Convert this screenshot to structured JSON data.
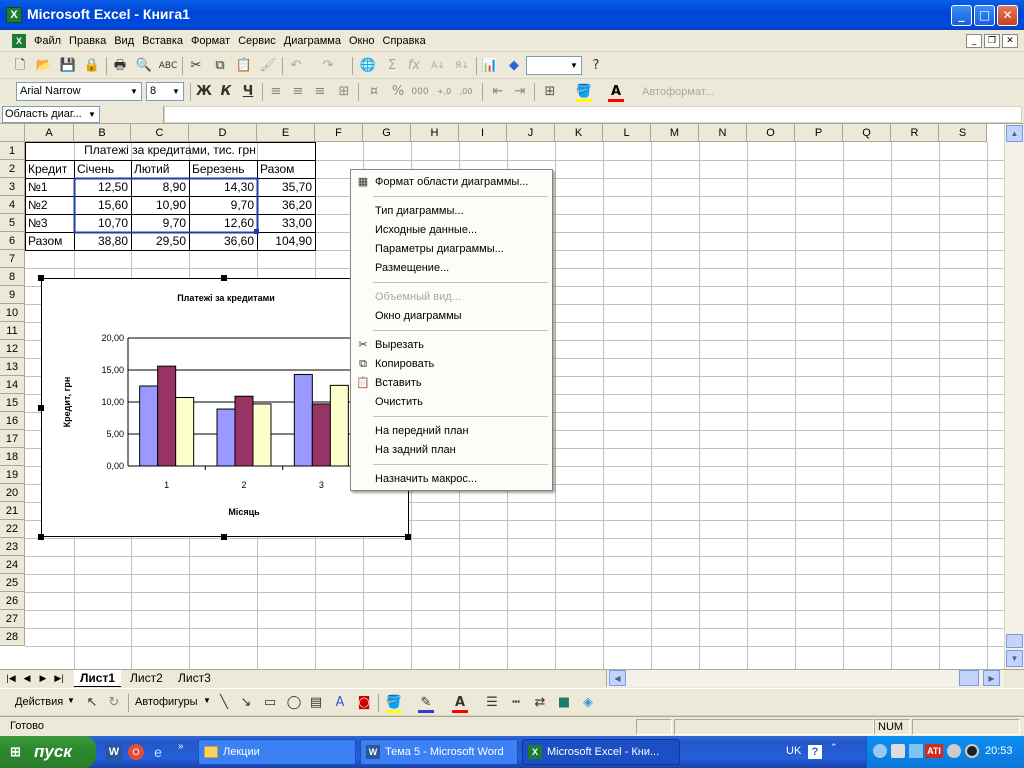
{
  "window": {
    "title": "Microsoft Excel - Книга1",
    "app_icon": "excel-icon",
    "min": "_",
    "max": "□",
    "close": "✕"
  },
  "menu": {
    "items": [
      "Файл",
      "Правка",
      "Вид",
      "Вставка",
      "Формат",
      "Сервис",
      "Диаграмма",
      "Окно",
      "Справка"
    ]
  },
  "formatting": {
    "font": "Arial Narrow",
    "size": "8",
    "bold": "Ж",
    "italic": "К",
    "underline": "Ч",
    "percent": "%",
    "thousands": "000",
    "inc_dec": "+,0",
    "dec_dec": ",00",
    "autoformat": "Автоформат..."
  },
  "formula_bar": {
    "name_box": "Область диаг..."
  },
  "grid": {
    "columns": [
      "A",
      "B",
      "C",
      "D",
      "E",
      "F",
      "G",
      "H",
      "I",
      "J",
      "K",
      "L",
      "M",
      "N",
      "O",
      "P",
      "Q",
      "R",
      "S"
    ],
    "rows": [
      "1",
      "2",
      "3",
      "4",
      "5",
      "6",
      "7",
      "8",
      "9",
      "10",
      "11",
      "12",
      "13",
      "14",
      "15",
      "16",
      "17",
      "18",
      "19",
      "20",
      "21",
      "22",
      "23",
      "24",
      "25",
      "26",
      "27",
      "28"
    ]
  },
  "table": {
    "title": "Платежі за кредитами, тис. грн",
    "headers": [
      "Кредит",
      "Січень",
      "Лютий",
      "Березень",
      "Разом"
    ],
    "rows": [
      [
        "№1",
        "12,50",
        "8,90",
        "14,30",
        "35,70"
      ],
      [
        "№2",
        "15,60",
        "10,90",
        "9,70",
        "36,20"
      ],
      [
        "№3",
        "10,70",
        "9,70",
        "12,60",
        "33,00"
      ],
      [
        "Разом",
        "38,80",
        "29,50",
        "36,60",
        "104,90"
      ]
    ]
  },
  "chart_data": {
    "type": "bar",
    "title": "Платежі за кредитами",
    "xlabel": "Місяць",
    "ylabel": "Кредит, грн",
    "categories": [
      "1",
      "2",
      "3"
    ],
    "series": [
      {
        "values": [
          12.5,
          8.9,
          14.3
        ],
        "color": "#9999ff"
      },
      {
        "values": [
          15.6,
          10.9,
          9.7
        ],
        "color": "#993366"
      },
      {
        "values": [
          10.7,
          9.7,
          12.6
        ],
        "color": "#ffffcc"
      }
    ],
    "ylim": [
      0,
      20
    ],
    "yticks": [
      "0,00",
      "5,00",
      "10,00",
      "15,00",
      "20,00"
    ],
    "grid": true
  },
  "context_menu": {
    "items": [
      {
        "label": "Формат области диаграммы...",
        "icon": "format-chart-icon",
        "enabled": true
      },
      {
        "label": "Тип диаграммы...",
        "enabled": true
      },
      {
        "label": "Исходные данные...",
        "enabled": true
      },
      {
        "label": "Параметры диаграммы...",
        "enabled": true
      },
      {
        "label": "Размещение...",
        "enabled": true
      },
      {
        "label": "Объемный вид...",
        "enabled": false
      },
      {
        "label": "Окно диаграммы",
        "enabled": true
      },
      {
        "label": "Вырезать",
        "icon": "scissors-icon",
        "enabled": true
      },
      {
        "label": "Копировать",
        "icon": "copy-icon",
        "enabled": true
      },
      {
        "label": "Вставить",
        "icon": "paste-icon",
        "enabled": true
      },
      {
        "label": "Очистить",
        "enabled": true
      },
      {
        "label": "На передний план",
        "enabled": true
      },
      {
        "label": "На задний план",
        "enabled": true
      },
      {
        "label": "Назначить макрос...",
        "enabled": true
      }
    ]
  },
  "sheets": {
    "tabs": [
      "Лист1",
      "Лист2",
      "Лист3"
    ],
    "active": "Лист1"
  },
  "drawing": {
    "actions": "Действия",
    "autoshapes": "Автофигуры"
  },
  "status": {
    "ready": "Готово",
    "num": "NUM"
  },
  "taskbar": {
    "start": "пуск",
    "tasks": [
      "Лекции",
      "Тема 5 - Microsoft Word",
      "Microsoft Excel - Кни..."
    ],
    "lang": "UK",
    "clock": "20:53"
  }
}
